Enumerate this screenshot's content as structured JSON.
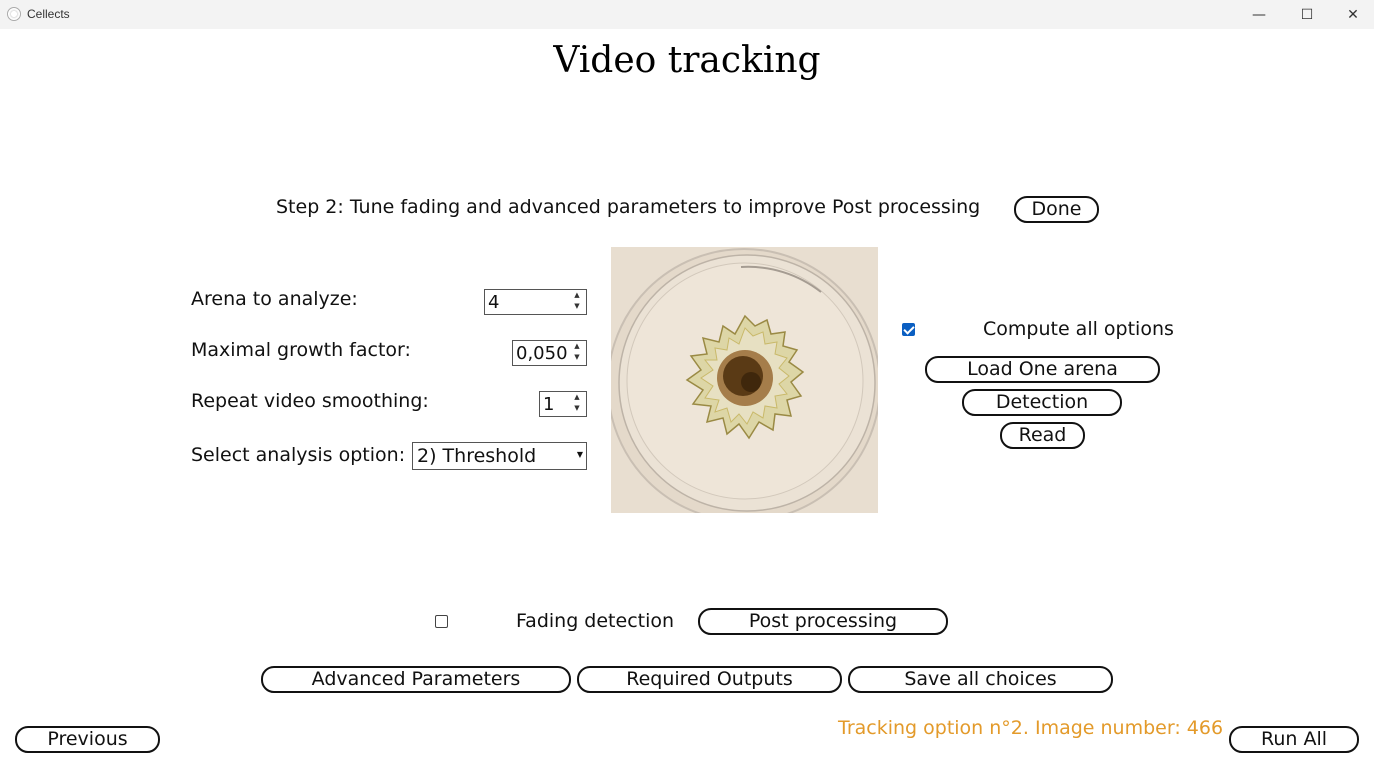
{
  "window": {
    "title": "Cellects",
    "minimize_glyph": "—",
    "maximize_glyph": "☐",
    "close_glyph": "✕"
  },
  "page": {
    "title": "Video tracking"
  },
  "step": {
    "text": "Step 2: Tune fading and advanced parameters to improve Post processing",
    "done_label": "Done"
  },
  "params": {
    "arena_label": "Arena to analyze:",
    "arena_value": "4",
    "growth_label": "Maximal growth factor:",
    "growth_value": "0,050",
    "smoothing_label": "Repeat video smoothing:",
    "smoothing_value": "1",
    "option_label": "Select analysis option:",
    "option_value": "2) Threshold"
  },
  "right_panel": {
    "compute_all_label": "Compute all options",
    "compute_all_checked": true,
    "load_one_arena_label": "Load One arena",
    "detection_label": "Detection",
    "read_label": "Read"
  },
  "bottom": {
    "fading_label": "Fading detection",
    "fading_checked": false,
    "post_processing_label": "Post processing",
    "advanced_label": "Advanced Parameters",
    "required_outputs_label": "Required Outputs",
    "save_choices_label": "Save all choices",
    "previous_label": "Previous",
    "run_all_label": "Run All",
    "status_text": "Tracking option n°2. Image number: 466"
  },
  "colors": {
    "status": "#e39a2a",
    "checkbox_accent": "#0b5fc2"
  }
}
